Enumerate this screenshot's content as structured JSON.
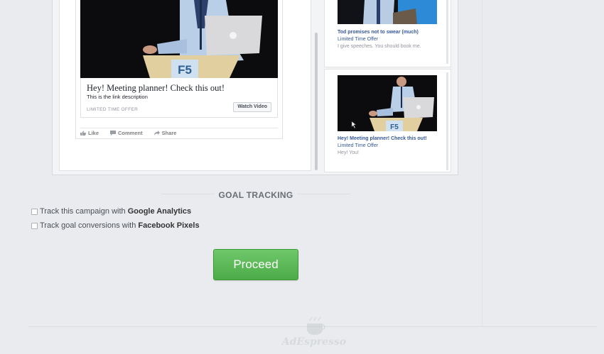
{
  "feed_post": {
    "link_title": "Hey! Meeting planner! Check this out!",
    "link_description": "This is the link description",
    "caption": "LIMITED TIME OFFER",
    "cta_label": "Watch Video",
    "podium_label": "F5",
    "actions": {
      "like": "Like",
      "comment": "Comment",
      "share": "Share"
    }
  },
  "right_column": {
    "ad1": {
      "title": "Tod promises not to swear (much)",
      "subtitle": "Limited Time Offer",
      "body": "I give speeches. You should book me."
    },
    "ad2": {
      "title": "Hey! Meeting planner! Check this out!",
      "subtitle": "Limited Time Offer",
      "body": "Hey! You!",
      "podium_label": "F5"
    }
  },
  "goal_tracking": {
    "heading": "GOAL TRACKING",
    "options": [
      {
        "prefix": "Track this campaign with ",
        "bold": "Google Analytics",
        "checked": false
      },
      {
        "prefix": "Track goal conversions with ",
        "bold": "Facebook Pixels",
        "checked": false
      }
    ]
  },
  "proceed_label": "Proceed",
  "footer": {
    "brand": "AdEspresso"
  },
  "colors": {
    "primary_button": "#5cb85c",
    "link_blue": "#365899",
    "background": "#e9ebee"
  }
}
